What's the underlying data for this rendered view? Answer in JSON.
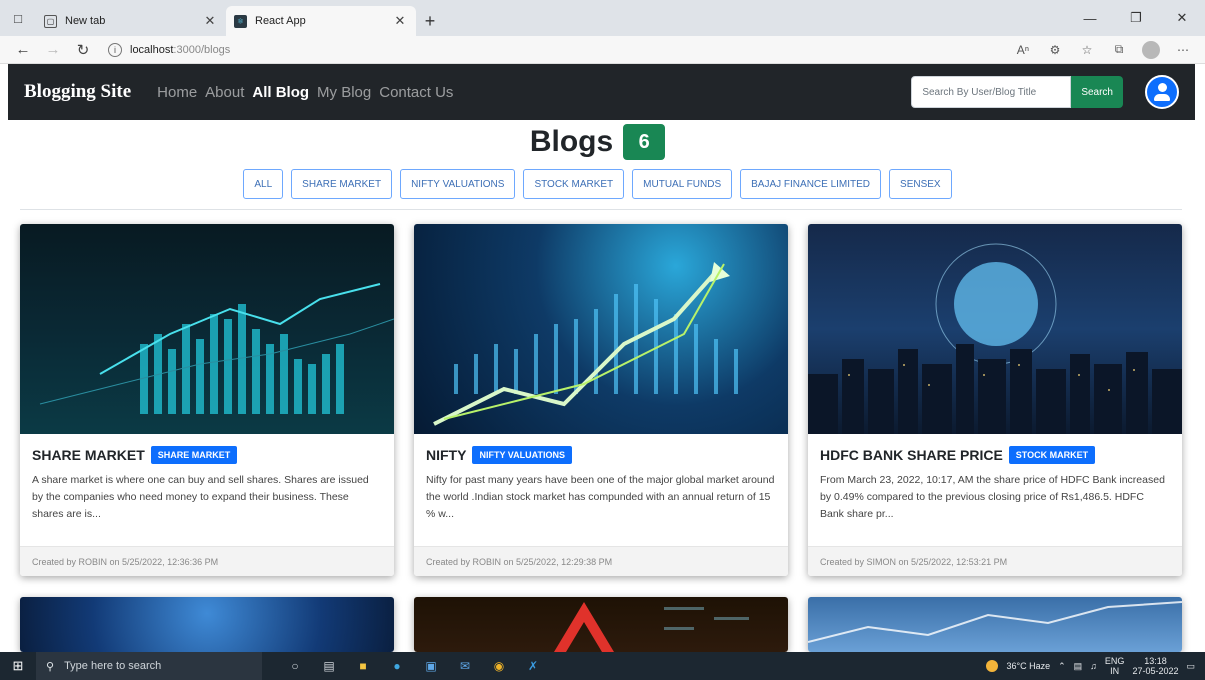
{
  "browser": {
    "tabs": [
      {
        "label": "New tab",
        "active": false
      },
      {
        "label": "React App",
        "active": true
      }
    ],
    "url_host": "localhost",
    "url_path": ":3000/blogs"
  },
  "navbar": {
    "brand": "Blogging Site",
    "links": [
      "Home",
      "About",
      "All Blog",
      "My Blog",
      "Contact Us"
    ],
    "active_link": "All Blog",
    "search_placeholder": "Search By User/Blog Title",
    "search_button": "Search"
  },
  "page": {
    "title": "Blogs",
    "count": "6",
    "filters": [
      "ALL",
      "SHARE MARKET",
      "NIFTY VALUATIONS",
      "STOCK MARKET",
      "MUTUAL FUNDS",
      "BAJAJ FINANCE LIMITED",
      "SENSEX"
    ]
  },
  "cards": [
    {
      "title": "SHARE MARKET",
      "tag": "SHARE MARKET",
      "description": "A share market is where one can buy and sell shares. Shares are issued by the companies who need money to expand their business. These shares are is...",
      "footer": "Created by ROBIN on 5/25/2022, 12:36:36 PM"
    },
    {
      "title": "NIFTY",
      "tag": "NIFTY VALUATIONS",
      "description": "Nifty for past many years have been one of the major global market around the world .Indian stock market has compunded with an annual return of 15 % w...",
      "footer": "Created by ROBIN on 5/25/2022, 12:29:38 PM"
    },
    {
      "title": "HDFC BANK SHARE PRICE",
      "tag": "STOCK MARKET",
      "description": "From March 23, 2022, 10:17, AM the share price of HDFC Bank increased by 0.49% compared to the previous closing price of Rs1,486.5. HDFC Bank share pr...",
      "footer": "Created by SIMON on 5/25/2022, 12:53:21 PM"
    }
  ],
  "taskbar": {
    "search_placeholder": "Type here to search",
    "weather": "36°C Haze",
    "lang_top": "ENG",
    "lang_bottom": "IN",
    "time": "13:18",
    "date": "27-05-2022"
  }
}
